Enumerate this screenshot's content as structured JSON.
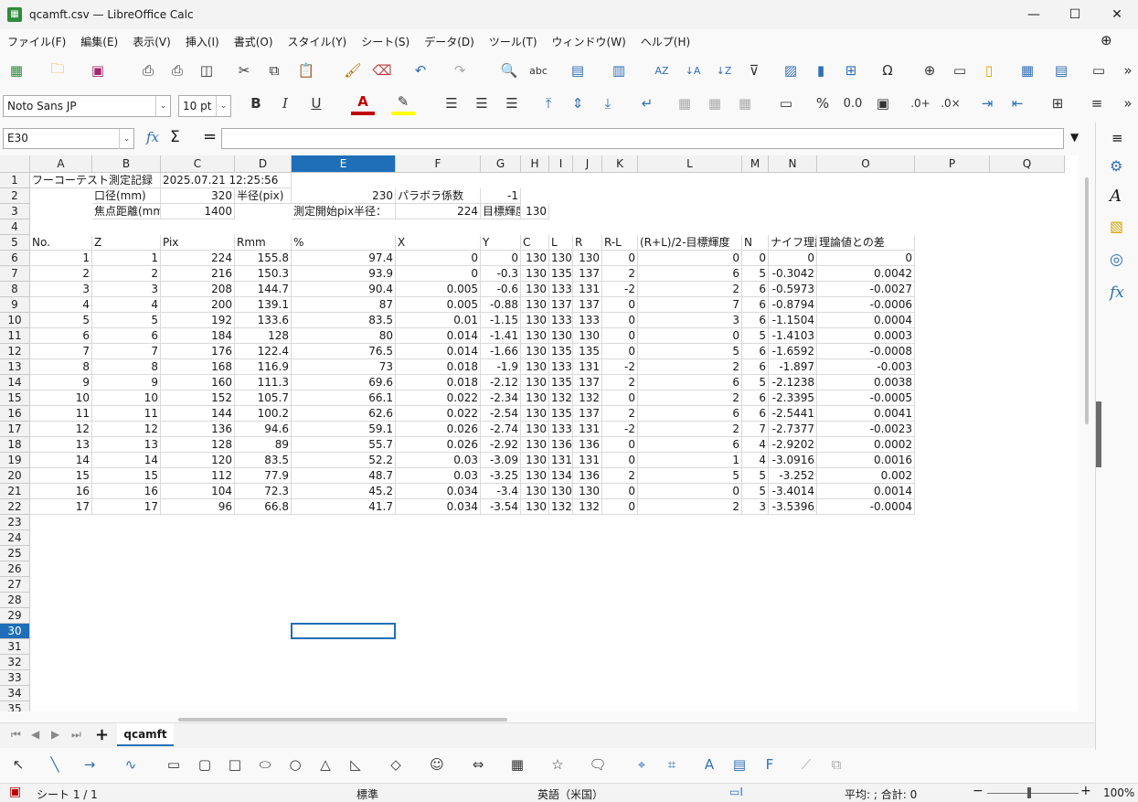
{
  "window": {
    "title": "qcamft.csv — LibreOffice Calc",
    "minimize": "—",
    "maximize": "☐",
    "close": "✕"
  },
  "menu": [
    "ファイル(F)",
    "編集(E)",
    "表示(V)",
    "挿入(I)",
    "書式(O)",
    "スタイル(Y)",
    "シート(S)",
    "データ(D)",
    "ツール(T)",
    "ウィンドウ(W)",
    "ヘルプ(H)"
  ],
  "toolbar": {
    "font_name": "Noto Sans JP",
    "font_size": "10 pt",
    "bold": "B",
    "italic": "I",
    "underline": "U",
    "percent": "%",
    "decimals": "0.0"
  },
  "formula_bar": {
    "name_box": "E30",
    "fx": "fx",
    "sum": "Σ",
    "equals": "=",
    "content": ""
  },
  "columns": [
    "A",
    "B",
    "C",
    "D",
    "E",
    "F",
    "G",
    "H",
    "I",
    "J",
    "K",
    "L",
    "M",
    "N",
    "O",
    "P",
    "Q"
  ],
  "rows": [
    "1",
    "2",
    "3",
    "4",
    "5",
    "6",
    "7",
    "8",
    "9",
    "10",
    "11",
    "12",
    "13",
    "14",
    "15",
    "16",
    "17",
    "18",
    "19",
    "20",
    "21",
    "22",
    "23",
    "24",
    "25",
    "26",
    "27",
    "28",
    "29",
    "30",
    "31",
    "32",
    "33",
    "34",
    "35"
  ],
  "selected": {
    "column": "E",
    "row": "30"
  },
  "cells": {
    "r1": [
      "フーコーテスト測定記録",
      "",
      "2025.07.21 12:25:56"
    ],
    "r2": {
      "B": "口径(mm)",
      "C": "320",
      "D": "半径(pix)",
      "E": "230",
      "F": "パラボラ係数",
      "G": "-1"
    },
    "r3": {
      "B": "焦点距離(mm)",
      "C": "1400",
      "E": "測定開始pix半径：",
      "F": "224",
      "G": "目標輝度",
      "H": "130"
    },
    "r5": [
      "No.",
      "Z",
      "Pix",
      "Rmm",
      "%",
      "X",
      "Y",
      "C",
      "L",
      "R",
      "R-L",
      "(R+L)/2-目標輝度",
      "N",
      "ナイフ理論値",
      "理論値との差"
    ],
    "data": [
      [
        "1",
        "1",
        "224",
        "155.8",
        "97.4",
        "0",
        "0",
        "130",
        "130",
        "130",
        "0",
        "0",
        "0",
        "0",
        "0"
      ],
      [
        "2",
        "2",
        "216",
        "150.3",
        "93.9",
        "0",
        "-0.3",
        "130",
        "135",
        "137",
        "2",
        "6",
        "5",
        "-0.3042",
        "0.0042"
      ],
      [
        "3",
        "3",
        "208",
        "144.7",
        "90.4",
        "0.005",
        "-0.6",
        "130",
        "133",
        "131",
        "-2",
        "2",
        "6",
        "-0.5973",
        "-0.0027"
      ],
      [
        "4",
        "4",
        "200",
        "139.1",
        "87",
        "0.005",
        "-0.88",
        "130",
        "137",
        "137",
        "0",
        "7",
        "6",
        "-0.8794",
        "-0.0006"
      ],
      [
        "5",
        "5",
        "192",
        "133.6",
        "83.5",
        "0.01",
        "-1.15",
        "130",
        "133",
        "133",
        "0",
        "3",
        "6",
        "-1.1504",
        "0.0004"
      ],
      [
        "6",
        "6",
        "184",
        "128",
        "80",
        "0.014",
        "-1.41",
        "130",
        "130",
        "130",
        "0",
        "0",
        "5",
        "-1.4103",
        "0.0003"
      ],
      [
        "7",
        "7",
        "176",
        "122.4",
        "76.5",
        "0.014",
        "-1.66",
        "130",
        "135",
        "135",
        "0",
        "5",
        "6",
        "-1.6592",
        "-0.0008"
      ],
      [
        "8",
        "8",
        "168",
        "116.9",
        "73",
        "0.018",
        "-1.9",
        "130",
        "133",
        "131",
        "-2",
        "2",
        "6",
        "-1.897",
        "-0.003"
      ],
      [
        "9",
        "9",
        "160",
        "111.3",
        "69.6",
        "0.018",
        "-2.12",
        "130",
        "135",
        "137",
        "2",
        "6",
        "5",
        "-2.1238",
        "0.0038"
      ],
      [
        "10",
        "10",
        "152",
        "105.7",
        "66.1",
        "0.022",
        "-2.34",
        "130",
        "132",
        "132",
        "0",
        "2",
        "6",
        "-2.3395",
        "-0.0005"
      ],
      [
        "11",
        "11",
        "144",
        "100.2",
        "62.6",
        "0.022",
        "-2.54",
        "130",
        "135",
        "137",
        "2",
        "6",
        "6",
        "-2.5441",
        "0.0041"
      ],
      [
        "12",
        "12",
        "136",
        "94.6",
        "59.1",
        "0.026",
        "-2.74",
        "130",
        "133",
        "131",
        "-2",
        "2",
        "7",
        "-2.7377",
        "-0.0023"
      ],
      [
        "13",
        "13",
        "128",
        "89",
        "55.7",
        "0.026",
        "-2.92",
        "130",
        "136",
        "136",
        "0",
        "6",
        "4",
        "-2.9202",
        "0.0002"
      ],
      [
        "14",
        "14",
        "120",
        "83.5",
        "52.2",
        "0.03",
        "-3.09",
        "130",
        "131",
        "131",
        "0",
        "1",
        "4",
        "-3.0916",
        "0.0016"
      ],
      [
        "15",
        "15",
        "112",
        "77.9",
        "48.7",
        "0.03",
        "-3.25",
        "130",
        "134",
        "136",
        "2",
        "5",
        "5",
        "-3.252",
        "0.002"
      ],
      [
        "16",
        "16",
        "104",
        "72.3",
        "45.2",
        "0.034",
        "-3.4",
        "130",
        "130",
        "130",
        "0",
        "0",
        "5",
        "-3.4014",
        "0.0014"
      ],
      [
        "17",
        "17",
        "96",
        "66.8",
        "41.7",
        "0.034",
        "-3.54",
        "130",
        "132",
        "132",
        "0",
        "2",
        "3",
        "-3.5396",
        "-0.0004"
      ]
    ]
  },
  "sheet_tab": "qcamft",
  "add_sheet": "+",
  "status": {
    "sheet": "シート 1 / 1",
    "style": "標準",
    "language": "英語（米国）",
    "summary": "平均: ; 合計: 0",
    "zoom": "100%"
  }
}
